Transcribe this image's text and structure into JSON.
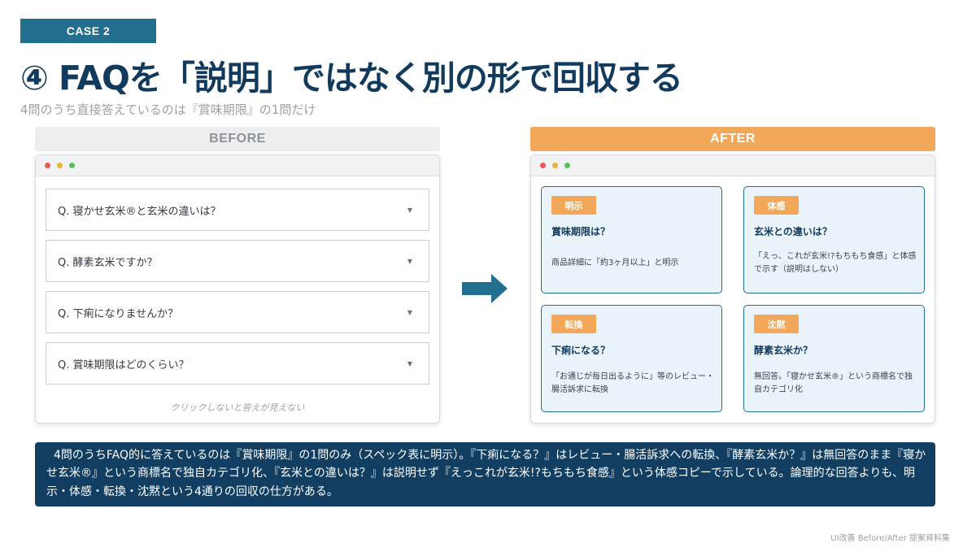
{
  "case_tag": "CASE 2",
  "title": "④ FAQを「説明」ではなく別の形で回収する",
  "subtitle": "4問のうち直接答えているのは『賞味期限』の1問だけ",
  "before": {
    "header": "BEFORE",
    "faq_items": [
      {
        "q": "Q. 寝かせ玄米®と玄米の違いは？",
        "arrow": "▼"
      },
      {
        "q": "Q. 酵素玄米ですか？",
        "arrow": "▼"
      },
      {
        "q": "Q. 下痢になりませんか？",
        "arrow": "▼"
      },
      {
        "q": "Q. 賞味期限はどのくらい？",
        "arrow": "▼"
      }
    ],
    "note": "クリックしないと答えが見えない"
  },
  "after": {
    "header": "AFTER",
    "cards": [
      {
        "badge": "明示",
        "title": "賞味期限は？",
        "desc": "商品詳細に「約3ヶ月以上」と明示"
      },
      {
        "badge": "体感",
        "title": "玄米との違いは？",
        "desc": "「えっ、これが玄米!?もちもち食感」と体感で示す（説明はしない）"
      },
      {
        "badge": "転換",
        "title": "下痢になる？",
        "desc": "「お通じが毎日出るように」等のレビュー・腸活訴求に転換"
      },
      {
        "badge": "沈黙",
        "title": "酵素玄米か？",
        "desc": "無回答。「寝かせ玄米®」という商標名で独自カテゴリ化"
      }
    ]
  },
  "summary": "4問のうちFAQ的に答えているのは『賞味期限』の1問のみ（スペック表に明示）。『下痢になる？』はレビュー・腸活訴求への転換、『酵素玄米か？』は無回答のまま『寝かせ玄米®』という商標名で独自カテゴリ化、『玄米との違いは？』は説明せず『えっこれが玄米!?もちもち食感』という体感コピーで示している。論理的な回答よりも、明示・体感・転換・沈黙という4通りの回収の仕方がある。",
  "footer": "UI改善 Before/After 提案資料集",
  "colors": {
    "teal": "#236f8f",
    "navy": "#123f61",
    "orange": "#f2a75b"
  }
}
